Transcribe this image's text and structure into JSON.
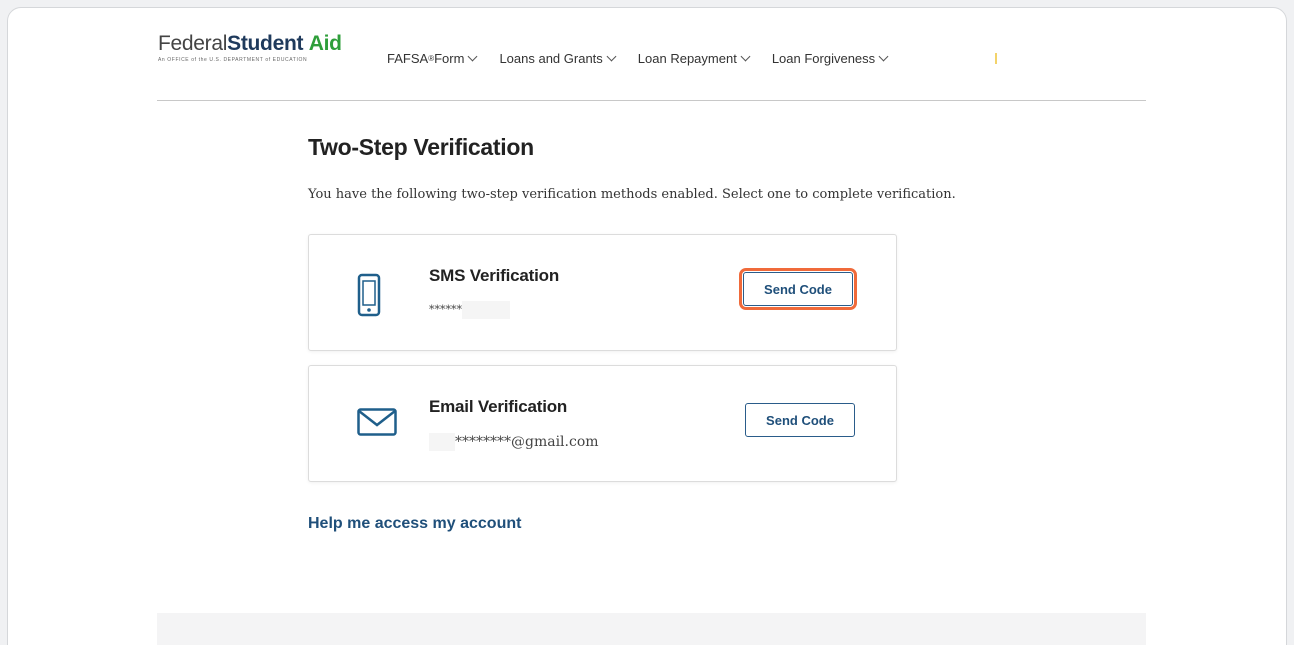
{
  "logo": {
    "word1": "Federal",
    "word2": "Student",
    "word3": "Aid",
    "tagline": "An OFFICE of the U.S. DEPARTMENT of EDUCATION"
  },
  "nav": {
    "items": [
      {
        "label": "FAFSA",
        "sup": "®",
        "suffix": " Form"
      },
      {
        "label": "Loans and Grants"
      },
      {
        "label": "Loan Repayment"
      },
      {
        "label": "Loan Forgiveness"
      }
    ]
  },
  "page": {
    "title": "Two-Step Verification",
    "subtitle": "You have the following two-step verification methods enabled. Select one to complete verification."
  },
  "methods": [
    {
      "title": "SMS Verification",
      "masked_value": "******",
      "button_label": "Send Code",
      "icon": "phone-icon",
      "highlighted": true
    },
    {
      "title": "Email Verification",
      "masked_value": "********@gmail.com",
      "button_label": "Send Code",
      "icon": "envelope-icon",
      "highlighted": false
    }
  ],
  "help_link": "Help me access my account",
  "colors": {
    "brand_navy": "#1f3a5c",
    "brand_green": "#2e9e3a",
    "link_blue": "#1f4f7a",
    "highlight_orange": "#f06a3a"
  }
}
